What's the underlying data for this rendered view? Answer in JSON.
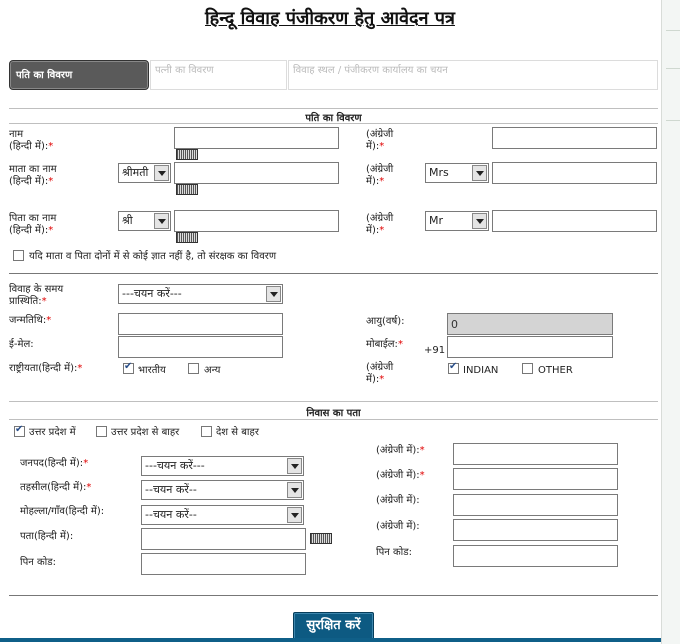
{
  "title": "हिन्दू विवाह पंजीकरण हेतु आवेदन पत्र",
  "tabs": [
    {
      "label": "पति का विवरण"
    },
    {
      "label": "पत्नी का विवरण"
    },
    {
      "label": "विवाह स्थल / पंजीकरण कार्यालय का चयन"
    }
  ],
  "husband_section": {
    "heading": "पति का विवरण",
    "name_label": "नाम\n(हिन्दी में):",
    "name_en_label": "(अंग्रेजी\nमें):",
    "mother_label": "माता का नाम\n(हिन्दी में):",
    "mother_prefix_hi": "श्रीमती",
    "mother_prefix_en": "Mrs",
    "father_label": "पिता का नाम\n(हिन्दी में):",
    "father_prefix_hi": "श्री",
    "father_prefix_en": "Mr",
    "guardian_checkbox": "यदि माता व पिता दोनों में से कोई ज्ञात नहीं है, तो संरक्षक का विवरण",
    "marital_status_label": "विवाह के समय\nप्रास्थिति:",
    "marital_status_value": "---चयन करें---",
    "dob_label": "जन्मतिथि:",
    "age_label": "आयु(वर्ष):",
    "age_value": "0",
    "email_label": "ई-मेल:",
    "mobile_label": "मोबाईल:",
    "mobile_prefix": "+91",
    "nationality_label": "राष्ट्रीयता(हिन्दी में):",
    "nationality_hi_opt1": "भारतीय",
    "nationality_hi_opt2": "अन्य",
    "nationality_en_label": "(अंग्रेजी\nमें):",
    "nationality_en_opt1": "INDIAN",
    "nationality_en_opt2": "OTHER"
  },
  "residence_section": {
    "heading": "निवास का पता",
    "loc_opt1": "उत्तर प्रदेश में",
    "loc_opt2": "उत्तर प्रदेश से बाहर",
    "loc_opt3": "देश से बाहर",
    "district_label": "जनपद(हिन्दी में):",
    "district_value": "---चयन करें---",
    "tehsil_label": "तहसील(हिन्दी में):",
    "tehsil_value": "--चयन करें--",
    "locality_label": "मोहल्ला/गाँव(हिन्दी में):",
    "locality_value": "--चयन करें--",
    "address_label": "पता(हिन्दी में):",
    "pin_label": "पिन कोड:",
    "en_label": "(अंग्रेजी में):",
    "en_pin_label": "पिन कोड:"
  },
  "save_button": "सुरक्षित करें"
}
